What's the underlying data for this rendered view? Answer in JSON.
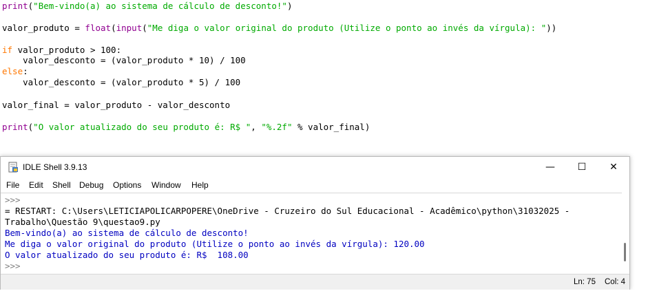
{
  "editor": {
    "lines": [
      {
        "segments": [
          {
            "t": "print",
            "c": "bi"
          },
          {
            "t": "(",
            "c": ""
          },
          {
            "t": "\"Bem-vindo(a) ao sistema de cálculo de desconto!\"",
            "c": "str"
          },
          {
            "t": ")",
            "c": ""
          }
        ]
      },
      {
        "segments": [
          {
            "t": "valor_produto = ",
            "c": ""
          },
          {
            "t": "float",
            "c": "bi"
          },
          {
            "t": "(",
            "c": ""
          },
          {
            "t": "input",
            "c": "bi"
          },
          {
            "t": "(",
            "c": ""
          },
          {
            "t": "\"Me diga o valor original do produto (Utilize o ponto ao invés da vírgula): \"",
            "c": "str"
          },
          {
            "t": "))",
            "c": ""
          }
        ]
      },
      {
        "segments": [
          {
            "t": "if",
            "c": "kw"
          },
          {
            "t": " valor_produto > 100:",
            "c": ""
          }
        ]
      },
      {
        "segments": [
          {
            "t": "    valor_desconto = (valor_produto * 10) / 100",
            "c": ""
          }
        ]
      },
      {
        "segments": [
          {
            "t": "else",
            "c": "kw"
          },
          {
            "t": ":",
            "c": ""
          }
        ]
      },
      {
        "segments": [
          {
            "t": "    valor_desconto = (valor_produto * 5) / 100",
            "c": ""
          }
        ]
      },
      {
        "segments": [
          {
            "t": "valor_final = valor_produto - valor_desconto",
            "c": ""
          }
        ]
      },
      {
        "segments": [
          {
            "t": "print",
            "c": "bi"
          },
          {
            "t": "(",
            "c": ""
          },
          {
            "t": "\"O valor atualizado do seu produto é: R$ \"",
            "c": "str"
          },
          {
            "t": ", ",
            "c": ""
          },
          {
            "t": "\"%.2f\"",
            "c": "str"
          },
          {
            "t": " % valor_final)",
            "c": ""
          }
        ]
      }
    ]
  },
  "shell": {
    "title": "IDLE Shell 3.9.13",
    "controls": {
      "minimize": "—",
      "maximize": "☐",
      "close": "✕"
    },
    "menu": [
      "File",
      "Edit",
      "Shell",
      "Debug",
      "Options",
      "Window",
      "Help"
    ],
    "lines": [
      {
        "text": ">>>",
        "c": "prompt"
      },
      {
        "text": "= RESTART: C:\\Users\\LETICIAPOLICARPOPERE\\OneDrive - Cruzeiro do Sul Educacional - Acadêmico\\python\\31032025 -",
        "c": ""
      },
      {
        "text": "Trabalho\\Questão 9\\questao9.py",
        "c": ""
      },
      {
        "text": "Bem-vindo(a) ao sistema de cálculo de desconto!",
        "c": "out"
      },
      {
        "text": "Me diga o valor original do produto (Utilize o ponto ao invés da vírgula): 120.00",
        "c": "out"
      },
      {
        "text": "O valor atualizado do seu produto é: R$  108.00",
        "c": "out"
      },
      {
        "text": ">>>",
        "c": "prompt"
      }
    ],
    "status": {
      "ln": "Ln: 75",
      "col": "Col: 4"
    }
  }
}
